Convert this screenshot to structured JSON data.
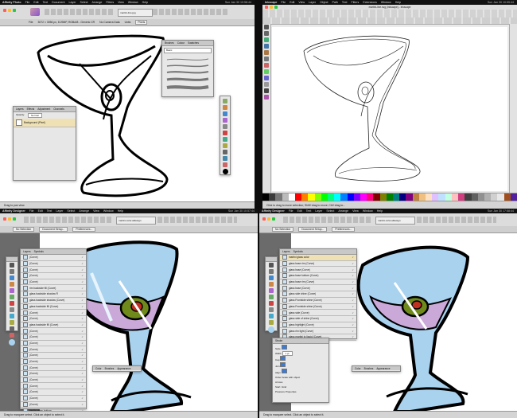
{
  "tl": {
    "menubar": [
      "Affinity Photo",
      "File",
      "Edit",
      "Text",
      "Document",
      "Layer",
      "Select",
      "Arrange",
      "Filters",
      "View",
      "Window",
      "Help"
    ],
    "clock": "Sun Jan 30 10:58:44",
    "file_tab": "martini-line.jpg",
    "context": [
      "File",
      "3072 × 3056 px, 8.29MP, RGBA/8 - Generic CR",
      "No Camera Data",
      "Units",
      "Pixels"
    ],
    "brushes_panel": {
      "tabs": [
        "Brushes",
        "Colour",
        "Swatches"
      ],
      "category": "Basic"
    },
    "layers_panel": {
      "tabs": [
        "Layers",
        "Effects",
        "Adjustment",
        "Channels"
      ],
      "opacity": "Opacity:",
      "blend": "Normal",
      "layer": "Background (Pixel)"
    },
    "status": "Drag to pan view."
  },
  "tr": {
    "menubar": [
      "Inkscape",
      "File",
      "Edit",
      "View",
      "Layer",
      "Object",
      "Path",
      "Text",
      "Filters",
      "Extensions",
      "Window",
      "Help"
    ],
    "clock": "Sun Jan 30 10:55:44",
    "title": "martini-line.svg (Inkscape) - Inkscape",
    "status": "Click to drag to move selection; Shift+drag to move; Ctrl+drag to..."
  },
  "bl": {
    "menubar": [
      "Affinity Designer",
      "File",
      "Edit",
      "Text",
      "Layer",
      "Select",
      "Arrange",
      "View",
      "Window",
      "Help"
    ],
    "clock": "Sun Jan 30 10:57:44",
    "file_tab": "martini-color.afdesign",
    "context_tabs": [
      "No Selection",
      "Document Setup...",
      "Preferences..."
    ],
    "layers_panel": {
      "tabs": [
        "Layers",
        "Symbols"
      ],
      "rows": [
        "(Curve)",
        "(Curve)",
        "(Curve)",
        "(Curve)",
        "(Curve)",
        "rim backside fill (Curve)",
        "glass backside shadow R",
        "glass backside shadow (Curve)",
        "glass backside fill (Curve)",
        "(Curve)",
        "(Curve)",
        "glass backside fill (Curve)",
        "(Curve)",
        "(Curve)",
        "(Curve)",
        "(Curve)",
        "(Curve)",
        "(Curve)",
        "(Curve)",
        "(Curve)",
        "(Curve)",
        "(Curve)",
        "(Curve)",
        "(Curve)",
        "(Curve)",
        "rim fin glass bottom",
        "(Curve)"
      ]
    },
    "bottom_tabs": [
      "Color",
      "Brushes",
      "Appearance"
    ],
    "status": "Drag to marquee select. Click an object to select it."
  },
  "br": {
    "menubar": [
      "Affinity Designer",
      "File",
      "Edit",
      "Text",
      "Layer",
      "Select",
      "Arrange",
      "View",
      "Window",
      "Help"
    ],
    "clock": "Sun Jan 30 17:58:44",
    "file_tab": "martini-color.afdesign",
    "context_tabs": [
      "No Selection",
      "Document Setup...",
      "Preferences..."
    ],
    "layers_panel": {
      "tabs": [
        "Layers",
        "Symbols"
      ],
      "rows": [
        "martini glass color",
        "glass base rim (Curve)",
        "glass base (Curve)",
        "glass base bottom (Curve)",
        "glass base rim (Curve)",
        "glass base (Curve)",
        "glass side shine (Curve)",
        "glass Frontside shine (Curve)",
        "glass Frontside shine (Curve)",
        "glass side (Curve)",
        "glass side of shine (Curve)",
        "glass highlight (Curve)",
        "glass rim light (Curve)",
        "glass martini to liquid (Curve)"
      ]
    },
    "stroke_panel": {
      "title": "Stroke",
      "labels": [
        "Style",
        "Width",
        "Cap",
        "Join",
        "Align",
        "Order",
        "Scale with object",
        "Arrows",
        "Start",
        "End",
        "Pressure",
        "Properties"
      ],
      "width_value": "1 pt",
      "scale": "Scale with object"
    },
    "bottom_tabs": [
      "Color",
      "Brushes",
      "Appearance"
    ],
    "status": "Drag to marquee select. Click an object to select it."
  },
  "palette": [
    "#000000",
    "#3a3a3a",
    "#777777",
    "#bbbbbb",
    "#ffffff",
    "#ff0000",
    "#ff7f00",
    "#ffff00",
    "#7fff00",
    "#00ff00",
    "#00ff7f",
    "#00ffff",
    "#007fff",
    "#0000ff",
    "#7f00ff",
    "#ff00ff",
    "#ff007f",
    "#800000",
    "#808000",
    "#008000",
    "#008080",
    "#000080",
    "#800080",
    "#c08040",
    "#f0c080",
    "#ffe0c0",
    "#e0c0ff",
    "#c0e0ff",
    "#c0ffe0",
    "#ffc0c0",
    "#d04080",
    "#404040",
    "#606060",
    "#909090",
    "#b0b0b0",
    "#d0d0d0",
    "#e8e8e8",
    "#a05020",
    "#5020a0"
  ],
  "colors": {
    "accent": "#3b7bd8",
    "liquid": "#caa8d8",
    "glass": "#a9d2ef",
    "olive": "#6f8a1a",
    "pimento": "#c03020",
    "canvas_bg": "#6b6b6b",
    "layer_highlight": "#efe1b4"
  }
}
